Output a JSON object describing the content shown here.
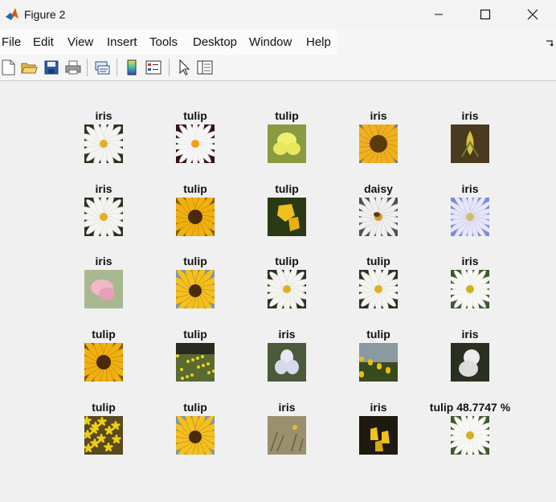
{
  "window": {
    "title": "Figure 2"
  },
  "menubar": {
    "items": [
      "File",
      "Edit",
      "View",
      "Insert",
      "Tools",
      "Desktop",
      "Window",
      "Help"
    ]
  },
  "grid": [
    {
      "label": "iris",
      "image": "white-daisy-dark-bg"
    },
    {
      "label": "tulip",
      "image": "white-daisy-maroon-bg"
    },
    {
      "label": "tulip",
      "image": "yellow-iris"
    },
    {
      "label": "iris",
      "image": "sunflower-closeup"
    },
    {
      "label": "iris",
      "image": "yellow-tulip-bud"
    },
    {
      "label": "iris",
      "image": "white-daisy-dark-bg"
    },
    {
      "label": "tulip",
      "image": "sunflower"
    },
    {
      "label": "tulip",
      "image": "yellow-tulips"
    },
    {
      "label": "daisy",
      "image": "daisy-with-bee"
    },
    {
      "label": "iris",
      "image": "purple-daisy-blue-bg"
    },
    {
      "label": "iris",
      "image": "pink-flower"
    },
    {
      "label": "tulip",
      "image": "sunflower-sky"
    },
    {
      "label": "tulip",
      "image": "white-daisy-dark-bg"
    },
    {
      "label": "tulip",
      "image": "white-daisy-dark-bg"
    },
    {
      "label": "iris",
      "image": "white-daisy-green-bg"
    },
    {
      "label": "tulip",
      "image": "sunflower"
    },
    {
      "label": "tulip",
      "image": "meadow-yellow-flowers"
    },
    {
      "label": "iris",
      "image": "white-iris"
    },
    {
      "label": "tulip",
      "image": "yellow-flowers-field"
    },
    {
      "label": "iris",
      "image": "white-iris-dark-bg"
    },
    {
      "label": "tulip",
      "image": "yellow-flowers-ground"
    },
    {
      "label": "tulip",
      "image": "sunflower-sky"
    },
    {
      "label": "iris",
      "image": "dry-grass-flower"
    },
    {
      "label": "iris",
      "image": "yellow-tulips-dark"
    },
    {
      "label": "tulip  48.7747 %",
      "image": "white-daisy-green-bg"
    }
  ]
}
